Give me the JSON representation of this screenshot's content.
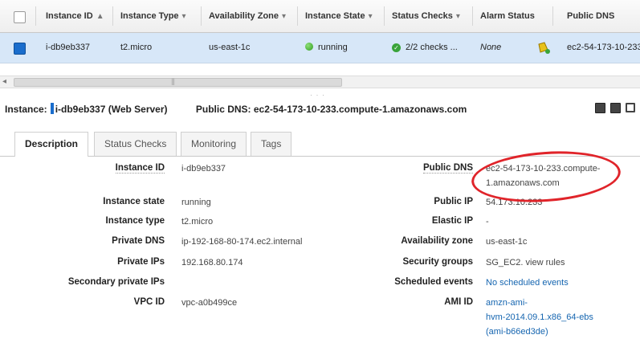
{
  "table": {
    "headers": {
      "instance_id": "Instance ID",
      "instance_id_sort": "▲",
      "instance_type": "Instance Type",
      "availability_zone": "Availability Zone",
      "instance_state": "Instance State",
      "status_checks": "Status Checks",
      "alarm_status": "Alarm Status",
      "public_dns": "Public DNS",
      "sort_icon": "▾"
    },
    "row": {
      "instance_id": "i-db9eb337",
      "instance_type": "t2.micro",
      "availability_zone": "us-east-1c",
      "instance_state": "running",
      "status_checks": "2/2 checks ...",
      "alarm_status": "None",
      "public_dns": "ec2-54-173-10-233"
    }
  },
  "details": {
    "instance_prefix": "Instance:",
    "instance_value": "i-db9eb337 (Web Server)",
    "public_dns_prefix": "Public DNS:",
    "public_dns_value": "ec2-54-173-10-233.compute-1.amazonaws.com"
  },
  "tabs": [
    "Description",
    "Status Checks",
    "Monitoring",
    "Tags"
  ],
  "description": {
    "left": [
      {
        "label": "Instance ID",
        "value": "i-db9eb337"
      },
      {
        "label": "Instance state",
        "value": "running"
      },
      {
        "label": "Instance type",
        "value": "t2.micro"
      },
      {
        "label": "Private DNS",
        "value": "ip-192-168-80-174.ec2.internal"
      },
      {
        "label": "Private IPs",
        "value": "192.168.80.174"
      },
      {
        "label": "Secondary private IPs",
        "value": ""
      },
      {
        "label": "VPC ID",
        "value": "vpc-a0b499ce"
      }
    ],
    "right": {
      "public_dns_label": "Public DNS",
      "public_dns_line1": "ec2-54-173-10-233.compute-",
      "public_dns_line2": "1.amazonaws.com",
      "public_ip_label": "Public IP",
      "public_ip": "54.173.10.233",
      "elastic_ip_label": "Elastic IP",
      "elastic_ip": "-",
      "az_label": "Availability zone",
      "az": "us-east-1c",
      "sg_label": "Security groups",
      "sg_link": "SG_EC2",
      "sg_sep": ".",
      "sg_view": "view rules",
      "events_label": "Scheduled events",
      "events": "No scheduled events",
      "ami_label": "AMI ID",
      "ami_line1": "amzn-ami-",
      "ami_line2": "hvm-2014.09.1.x86_64-ebs",
      "ami_line3": "(ami-b66ed3de)"
    }
  },
  "icons": {
    "alarm": "alarm-bell-icon",
    "running": "green-dot-icon",
    "status_ok": "green-check-icon"
  },
  "colors": {
    "selected_row": "#d7e7f8",
    "link": "#1565b0",
    "running": "#2f9b1c",
    "annotation": "#e0242a"
  }
}
